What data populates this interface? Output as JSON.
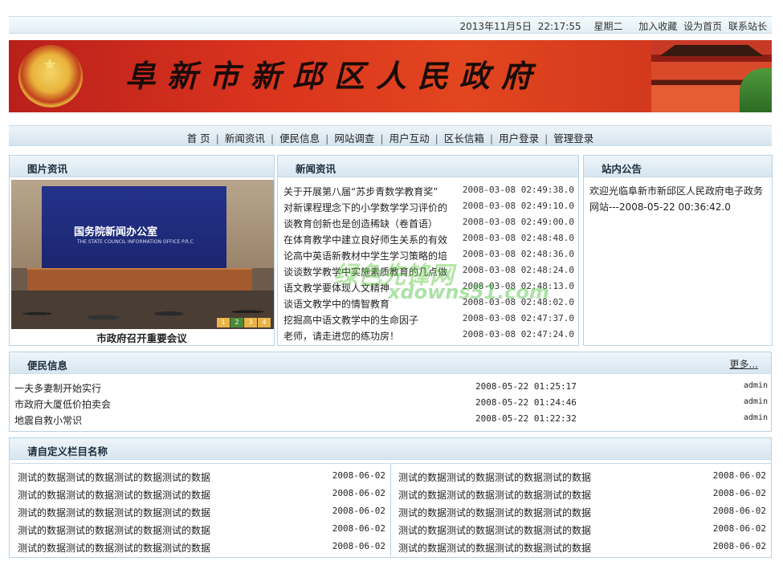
{
  "topbar": {
    "date": "2013年11月5日",
    "time": "22:17:55",
    "weekday": "星期二",
    "links": [
      "加入收藏",
      "设为首页",
      "联系站长"
    ]
  },
  "banner": {
    "title": "阜新市新邱区人民政府"
  },
  "nav": [
    "首 页",
    "新闻资讯",
    "便民信息",
    "网站调查",
    "用户互动",
    "区长信箱",
    "用户登录",
    "管理登录"
  ],
  "pic_panel": {
    "title": "图片资讯",
    "photo_board_text": "国务院新闻办公室",
    "photo_board_sub": "THE STATE COUNCIL INFORMATION OFFICE P.R.C",
    "slide_numbers": [
      "1",
      "2",
      "3",
      "4"
    ],
    "caption": "市政府召开重要会议"
  },
  "news_panel": {
    "title": "新闻资讯",
    "items": [
      {
        "title": "关于开展第八届“苏步青数学教育奖”",
        "date": "2008-03-08 02:49:38.0"
      },
      {
        "title": "对新课程理念下的小学数学学习评价的",
        "date": "2008-03-08 02:49:10.0"
      },
      {
        "title": "谈教育创新也是创造稀缺（卷首语）",
        "date": "2008-03-08 02:49:00.0"
      },
      {
        "title": "在体育教学中建立良好师生关系的有效",
        "date": "2008-03-08 02:48:48.0"
      },
      {
        "title": "论高中英语新教材中学生学习策略的培",
        "date": "2008-03-08 02:48:36.0"
      },
      {
        "title": "谈谈数学教学中实施素质教育的几点做",
        "date": "2008-03-08 02:48:24.0"
      },
      {
        "title": "语文教学要体现人文精神",
        "date": "2008-03-08 02:48:13.0"
      },
      {
        "title": "谈语文教学中的情智教育",
        "date": "2008-03-08 02:48:02.0"
      },
      {
        "title": "挖掘高中语文教学中的生命因子",
        "date": "2008-03-08 02:47:37.0"
      },
      {
        "title": "老师，请走进您的练功房！",
        "date": "2008-03-08 02:47:24.0"
      }
    ]
  },
  "notice_panel": {
    "title": "站内公告",
    "text": "欢迎光临阜新市新邱区人民政府电子政务网站---2008-05-22 00:36:42.0"
  },
  "life_panel": {
    "title": "便民信息",
    "more": "更多...",
    "items": [
      {
        "title": "一夫多妻制开始实行",
        "date": "2008-05-22 01:25:17",
        "user": "admin"
      },
      {
        "title": "市政府大厦低价拍卖会",
        "date": "2008-05-22 01:24:46",
        "user": "admin"
      },
      {
        "title": "地震自救小常识",
        "date": "2008-05-22 01:22:32",
        "user": "admin"
      }
    ]
  },
  "custom_panel": {
    "title": "请自定义栏目名称",
    "left": [
      {
        "title": "测试的数据测试的数据测试的数据测试的数据",
        "date": "2008-06-02"
      },
      {
        "title": "测试的数据测试的数据测试的数据测试的数据",
        "date": "2008-06-02"
      },
      {
        "title": "测试的数据测试的数据测试的数据测试的数据",
        "date": "2008-06-02"
      },
      {
        "title": "测试的数据测试的数据测试的数据测试的数据",
        "date": "2008-06-02"
      },
      {
        "title": "测试的数据测试的数据测试的数据测试的数据",
        "date": "2008-06-02"
      }
    ],
    "right": [
      {
        "title": "测试的数据测试的数据测试的数据测试的数据",
        "date": "2008-06-02"
      },
      {
        "title": "测试的数据测试的数据测试的数据测试的数据",
        "date": "2008-06-02"
      },
      {
        "title": "测试的数据测试的数据测试的数据测试的数据",
        "date": "2008-06-02"
      },
      {
        "title": "测试的数据测试的数据测试的数据测试的数据",
        "date": "2008-06-02"
      },
      {
        "title": "测试的数据测试的数据测试的数据测试的数据",
        "date": "2008-06-02"
      }
    ]
  },
  "watermark": {
    "text": "绿色先锋网",
    "sub": "xdowns51.com"
  }
}
